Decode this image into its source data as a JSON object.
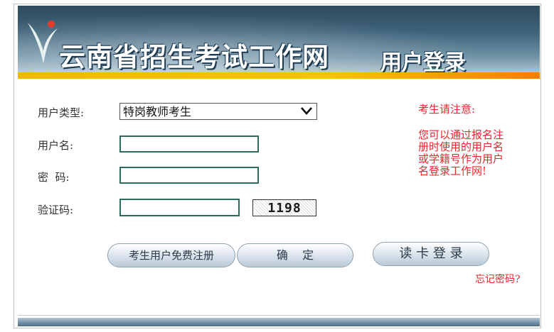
{
  "banner": {
    "title": "云南省招生考试工作网",
    "subtitle": "用户登录"
  },
  "form": {
    "user_type_label": "用户类型:",
    "user_type_value": "特岗教师考生",
    "username_label": "用户名:",
    "password_label": "密  码:",
    "captcha_label": "验证码:",
    "captcha_text": "1198"
  },
  "notice": {
    "title": "考生请注意:",
    "body": "您可以通过报名注册时使用的用户名或学籍号作为用户名登录工作网!"
  },
  "buttons": {
    "register": "考生用户免费注册",
    "confirm": "确    定",
    "card_login": "读 卡 登 录"
  },
  "links": {
    "forgot": "忘记密码?"
  },
  "colors": {
    "accent_red": "#e8262b",
    "field_border": "#2e6a5e",
    "banner_blue": "#3d6178",
    "banner_stripe": "#f5c400"
  }
}
